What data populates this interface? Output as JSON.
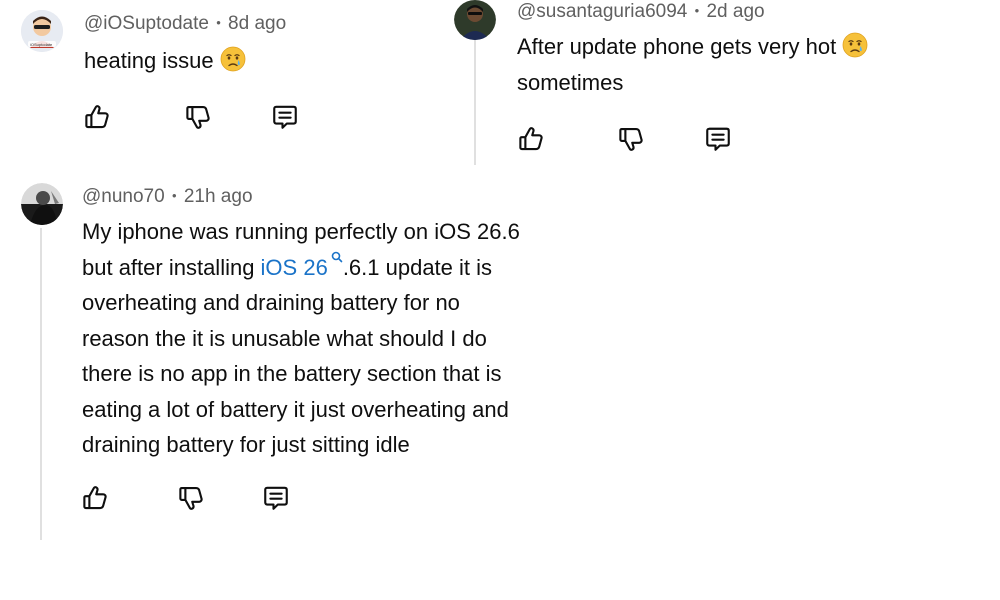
{
  "comments": [
    {
      "handle": "@iOSuptodate",
      "time": "8d ago",
      "text": "heating issue",
      "emoji": "crying-face",
      "avatar_text": "iOSuptodate"
    },
    {
      "handle": "@susantaguria6094",
      "time": "2d ago",
      "text": "After update phone gets very hot",
      "text2": "sometimes",
      "emoji": "crying-face"
    },
    {
      "handle": "@nuno70",
      "time": "21h ago",
      "lines": [
        "My iphone was running perfectly on iOS 26.6",
        "overheating and draining battery for no",
        "reason the it is unusable what should I do",
        "there is no app in the battery section that is",
        "eating a lot of battery it just overheating and",
        "draining battery for just sitting idle"
      ],
      "line2_before": "but after installing ",
      "line2_link": "iOS 26",
      "line2_after": ".6.1 update it is"
    }
  ],
  "separator": "•",
  "icons": [
    "like-icon",
    "dislike-icon",
    "reply-icon",
    "search-icon",
    "crying-face-emoji"
  ],
  "colors": {
    "meta": "#606060",
    "text": "#0f0f0f",
    "link": "#1a73c8",
    "thread": "#e0e0e0"
  }
}
